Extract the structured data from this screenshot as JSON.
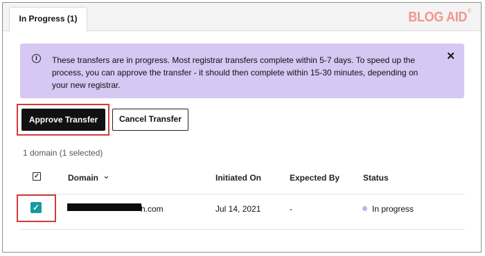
{
  "tab": {
    "label": "In Progress (1)"
  },
  "brand": {
    "logo_text": "BLOG AID",
    "logo_mark": "©",
    "color": "#f29691"
  },
  "alert": {
    "icon": "info-icon",
    "icon_glyph": "i",
    "text": "These transfers are in progress. Most registrar transfers complete within 5-7 days. To speed up the process, you can approve the transfer - it should then complete within 15-30 minutes, depending on your new registrar.",
    "close_glyph": "✕",
    "background": "#d6c7f3"
  },
  "actions": {
    "approve_label": "Approve Transfer",
    "cancel_label": "Cancel Transfer"
  },
  "selection_summary": "1 domain (1 selected)",
  "table": {
    "select_all_glyph": "✓",
    "columns": {
      "domain": "Domain",
      "initiated_on": "Initiated On",
      "expected_by": "Expected By",
      "status": "Status"
    },
    "sort_glyph": "⌄",
    "rows": [
      {
        "selected": true,
        "check_glyph": "✓",
        "domain_visible_suffix": "h.com",
        "initiated_on": "Jul 14, 2021",
        "expected_by": "-",
        "status": "In progress",
        "status_color": "#bdb3e6"
      }
    ]
  },
  "colors": {
    "approve_button": "#111111",
    "checkbox_checked": "#169b9e",
    "highlight_outline": "#d33a3a"
  }
}
